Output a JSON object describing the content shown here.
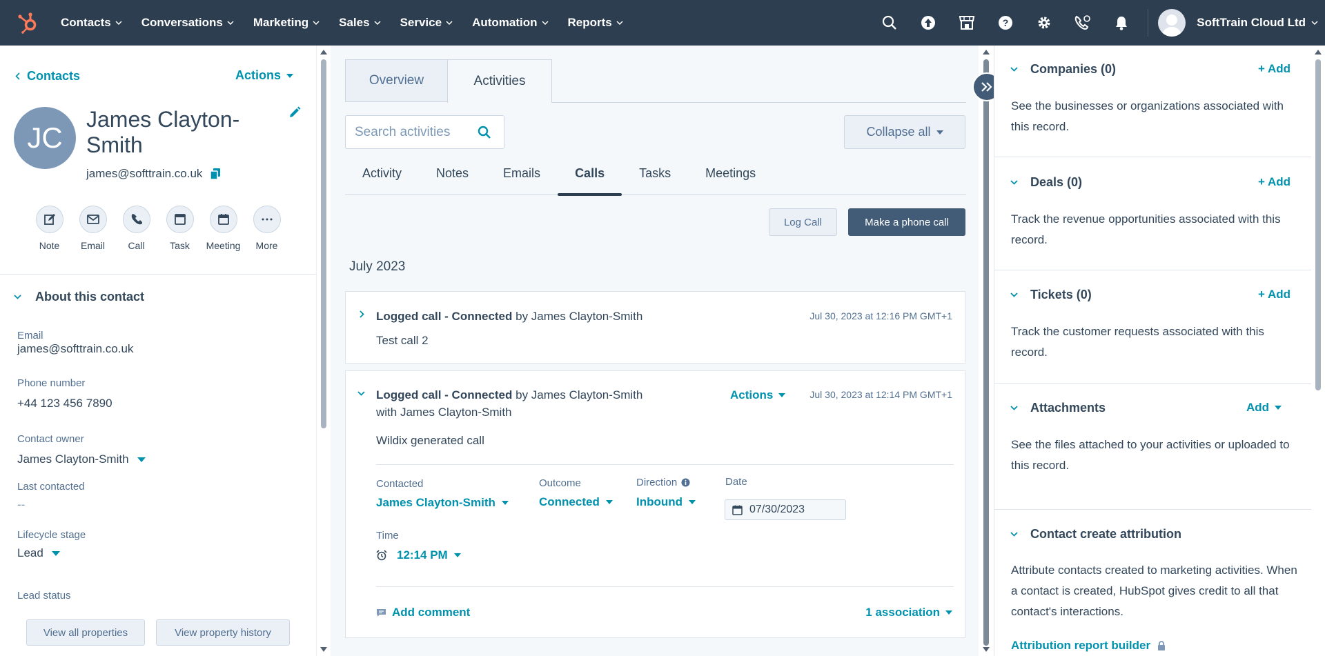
{
  "nav": {
    "items": [
      "Contacts",
      "Conversations",
      "Marketing",
      "Sales",
      "Service",
      "Automation",
      "Reports"
    ],
    "account": "SoftTrain Cloud Ltd",
    "icons": [
      "search-icon",
      "upgrade-icon",
      "marketplace-icon",
      "help-icon",
      "settings-icon",
      "calling-icon",
      "notifications-icon"
    ]
  },
  "left": {
    "back_label": "Contacts",
    "actions_label": "Actions",
    "initials": "JC",
    "name": "James Clayton-Smith",
    "email": "james@softtrain.co.uk",
    "quick_actions": [
      "Note",
      "Email",
      "Call",
      "Task",
      "Meeting",
      "More"
    ],
    "about_title": "About this contact",
    "props": {
      "email_label": "Email",
      "email_value": "james@softtrain.co.uk",
      "phone_label": "Phone number",
      "phone_value": "+44 123 456 7890",
      "owner_label": "Contact owner",
      "owner_value": "James Clayton-Smith",
      "last_label": "Last contacted",
      "last_value": "--",
      "lifecycle_label": "Lifecycle stage",
      "lifecycle_value": "Lead",
      "lead_status_label": "Lead status"
    },
    "btn_all_props": "View all properties",
    "btn_history": "View property history"
  },
  "middle": {
    "tabs": [
      "Overview",
      "Activities"
    ],
    "search_placeholder": "Search activities",
    "collapse_label": "Collapse all",
    "subtabs": [
      "Activity",
      "Notes",
      "Emails",
      "Calls",
      "Tasks",
      "Meetings"
    ],
    "active_subtab": "Calls",
    "log_call": "Log Call",
    "make_call": "Make a phone call",
    "month": "July 2023",
    "card1": {
      "title_bold": "Logged call - Connected",
      "title_rest": " by James Clayton-Smith",
      "date": "Jul 30, 2023 at 12:16 PM GMT+1",
      "body": "Test call 2"
    },
    "card2": {
      "title_bold": "Logged call - Connected",
      "title_rest": " by James Clayton-Smith",
      "title_line2": "with James Clayton-Smith",
      "actions_label": "Actions",
      "date": "Jul 30, 2023 at 12:14 PM GMT+1",
      "body": "Wildix generated call",
      "contacted_label": "Contacted",
      "contacted_value": "James Clayton-Smith",
      "outcome_label": "Outcome",
      "outcome_value": "Connected",
      "direction_label": "Direction",
      "direction_value": "Inbound",
      "date_label": "Date",
      "date_value": "07/30/2023",
      "time_label": "Time",
      "time_value": "12:14 PM",
      "add_comment": "Add comment",
      "association": "1 association"
    }
  },
  "right": {
    "companies_title": "Companies (0)",
    "companies_add": "+ Add",
    "companies_text": "See the businesses or organizations associated with this record.",
    "deals_title": "Deals (0)",
    "deals_add": "+ Add",
    "deals_text": "Track the revenue opportunities associated with this record.",
    "tickets_title": "Tickets (0)",
    "tickets_add": "+ Add",
    "tickets_text": "Track the customer requests associated with this record.",
    "attachments_title": "Attachments",
    "attachments_add": "Add",
    "attachments_text": "See the files attached to your activities or uploaded to this record.",
    "attribution_title": "Contact create attribution",
    "attribution_text": "Attribute contacts created to marketing activities. When a contact is created, HubSpot gives credit to all that contact's interactions.",
    "attribution_link": "Attribution report builder"
  },
  "colors": {
    "nav_bg": "#2d3e50",
    "brand_orange": "#ff7a59",
    "link": "#0091ae",
    "primary_button": "#425b76"
  }
}
